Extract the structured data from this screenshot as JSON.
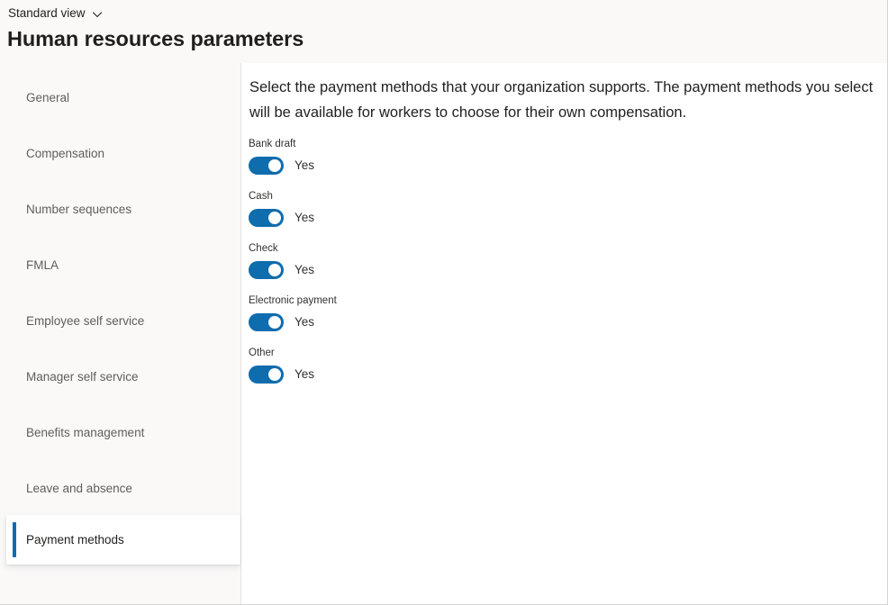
{
  "header": {
    "view_selector_label": "Standard view",
    "view_selector_icon": "chevron-down-icon",
    "title": "Human resources parameters"
  },
  "sidebar": {
    "items": [
      {
        "label": "General",
        "selected": false
      },
      {
        "label": "Compensation",
        "selected": false
      },
      {
        "label": "Number sequences",
        "selected": false
      },
      {
        "label": "FMLA",
        "selected": false
      },
      {
        "label": "Employee self service",
        "selected": false
      },
      {
        "label": "Manager self service",
        "selected": false
      },
      {
        "label": "Benefits management",
        "selected": false
      },
      {
        "label": "Leave and absence",
        "selected": false
      },
      {
        "label": "Payment methods",
        "selected": true
      }
    ]
  },
  "content": {
    "description": "Select the payment methods that your organization supports. The payment methods you select will be available for workers to choose for their own compensation.",
    "fields": [
      {
        "label": "Bank draft",
        "value": "Yes",
        "on": true
      },
      {
        "label": "Cash",
        "value": "Yes",
        "on": true
      },
      {
        "label": "Check",
        "value": "Yes",
        "on": true
      },
      {
        "label": "Electronic payment",
        "value": "Yes",
        "on": true
      },
      {
        "label": "Other",
        "value": "Yes",
        "on": true
      }
    ]
  },
  "colors": {
    "accent": "#0f6cad",
    "page_background": "#faf9f8",
    "panel_background": "#ffffff",
    "text_primary": "#201f1e",
    "text_secondary": "#605e5c"
  }
}
